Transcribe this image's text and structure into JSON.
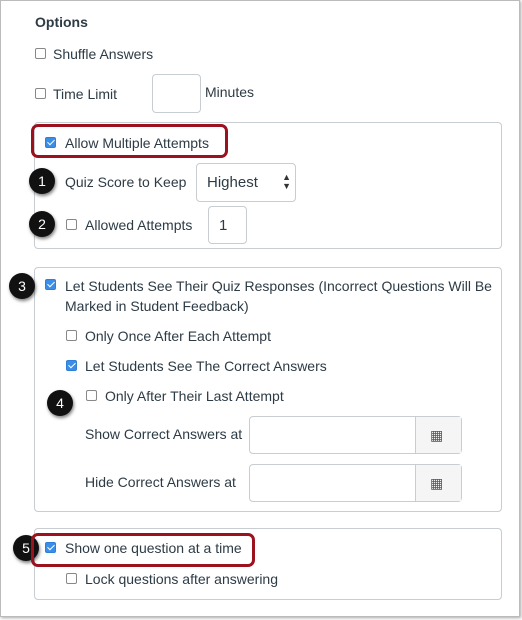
{
  "title": "Options",
  "shuffle": {
    "label": "Shuffle Answers",
    "checked": false
  },
  "time_limit": {
    "label": "Time Limit",
    "value": "",
    "unit": "Minutes",
    "checked": false
  },
  "multiple": {
    "label": "Allow Multiple Attempts",
    "checked": true,
    "score_label": "Quiz Score to Keep",
    "score_value": "Highest",
    "allowed_label": "Allowed Attempts",
    "allowed_value": "1",
    "allowed_checked": false
  },
  "responses": {
    "label_line1": "Let Students See Their Quiz Responses (Incorrect Questions Will Be",
    "label_line2": "Marked in Student Feedback)",
    "checked": true,
    "once_label": "Only Once After Each Attempt",
    "correct_label": "Let Students See The Correct Answers",
    "last_label": "Only After Their Last Attempt",
    "show_label": "Show Correct Answers at",
    "hide_label": "Hide Correct Answers at"
  },
  "one_question": {
    "label": "Show one question at a time",
    "checked": true,
    "lock_label": "Lock questions after answering"
  },
  "badges": [
    "1",
    "2",
    "3",
    "4",
    "5"
  ],
  "colors": {
    "highlight": "#9b111e",
    "checkbox": "#3b8ee8"
  }
}
